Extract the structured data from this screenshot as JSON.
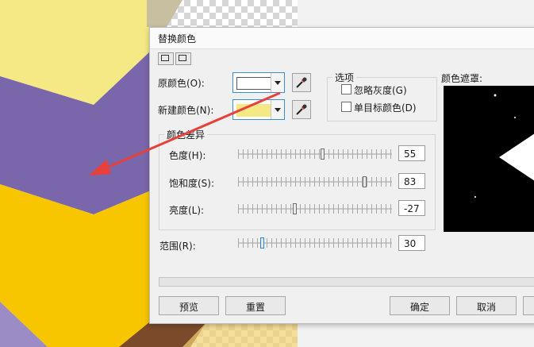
{
  "dialog": {
    "title": "替换颜色",
    "original_color": {
      "label": "原颜色(O):",
      "swatch_color": "#ffffff"
    },
    "new_color": {
      "label": "新建颜色(N):",
      "swatch_color": "#f4e984"
    },
    "options": {
      "group_label": "选项",
      "ignore_gray": "忽略灰度(G)",
      "single_target": "单目标颜色(D)"
    },
    "color_mask_label": "颜色遮罩:",
    "diff": {
      "group_label": "颜色差异",
      "hue": {
        "label": "色度(H):",
        "value": "55",
        "level": 55
      },
      "saturation": {
        "label": "饱和度(S):",
        "value": "83",
        "level": 83
      },
      "lightness": {
        "label": "亮度(L):",
        "value": "-27",
        "level": -27
      }
    },
    "range": {
      "label": "范围(R):",
      "value": "30",
      "level": 30
    },
    "buttons": {
      "preview": "预览",
      "reset": "重置",
      "ok": "确定",
      "cancel": "取消"
    }
  },
  "colors": {
    "accent": "#3a8fd6",
    "purple": "#7a67ab",
    "yellow": "#f4e984",
    "gold": "#f7c600",
    "arrow": "#e8403a"
  }
}
